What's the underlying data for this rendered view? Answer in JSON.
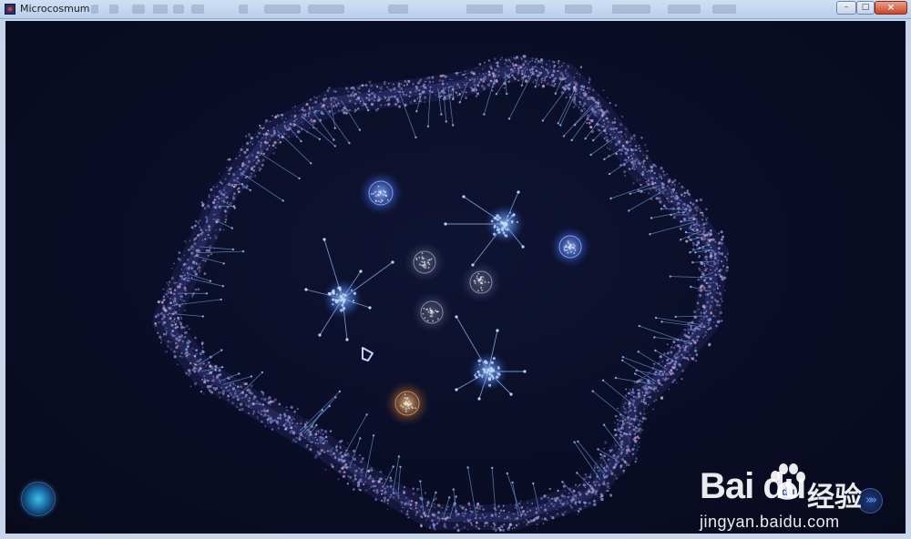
{
  "window": {
    "title": "Microcosmum",
    "controls": {
      "minimize": "–",
      "maximize": "□",
      "close": "×"
    }
  },
  "game": {
    "hud_left_icon": "abilities-orb-icon",
    "hud_right_icon": "fast-forward-icon",
    "hud_right_label": "»»",
    "colors": {
      "background": "#0a0d26",
      "membrane": "#8a92d8",
      "player_cell": "#7da7ff",
      "neutral_cell": "#9aa0c4",
      "enemy_cell": "#e8a060",
      "cursor": "#c9d2ff"
    }
  },
  "watermark": {
    "logo": "Bai du",
    "cn": "经验",
    "url": "jingyan.baidu.com"
  }
}
